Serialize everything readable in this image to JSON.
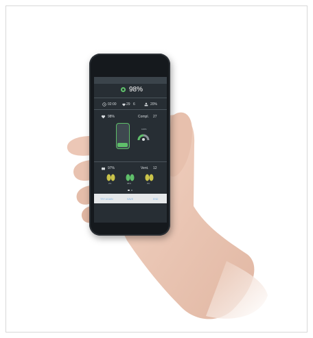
{
  "screen": {
    "spo2": "98%",
    "status_row": {
      "time": "02:00",
      "pulse": "29",
      "airflow": "6",
      "ratio": "20%"
    },
    "heart": {
      "percent": "98%",
      "label": "Compl.",
      "value": "27"
    },
    "gauge": {
      "percent": "100%"
    },
    "lungs": {
      "percent": "97%",
      "label": "Vent.",
      "value": "12",
      "captions": [
        "2%",
        "98%",
        "0%"
      ]
    },
    "buttons": [
      "TRY AGAIN",
      "SAVE",
      "END"
    ]
  },
  "colors": {
    "accent_green": "#5fbf6a",
    "lung_yellow": "#c9c34a",
    "screen_bg": "#272e34"
  },
  "icons": [
    "signal-icon",
    "heart-icon",
    "clock-icon",
    "lung-icon",
    "person-icon"
  ]
}
